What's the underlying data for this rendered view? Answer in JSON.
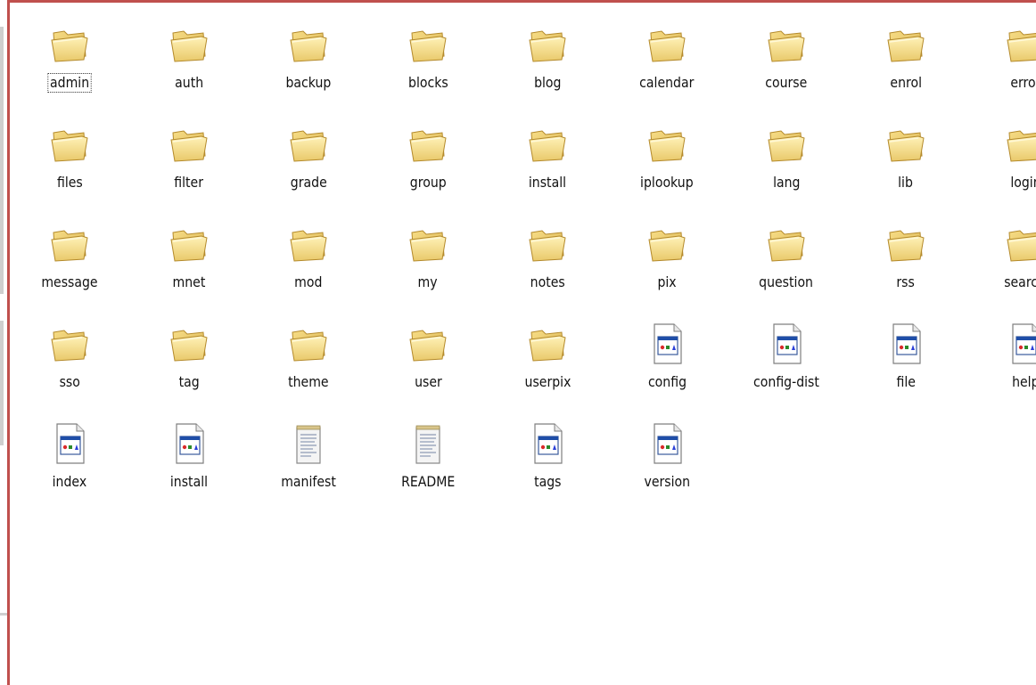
{
  "window": {
    "accent": "#c0504d"
  },
  "files": [
    {
      "name": "admin",
      "type": "folder",
      "focused": true
    },
    {
      "name": "auth",
      "type": "folder"
    },
    {
      "name": "backup",
      "type": "folder"
    },
    {
      "name": "blocks",
      "type": "folder"
    },
    {
      "name": "blog",
      "type": "folder"
    },
    {
      "name": "calendar",
      "type": "folder"
    },
    {
      "name": "course",
      "type": "folder"
    },
    {
      "name": "enrol",
      "type": "folder"
    },
    {
      "name": "error",
      "type": "folder"
    },
    {
      "name": "files",
      "type": "folder"
    },
    {
      "name": "filter",
      "type": "folder"
    },
    {
      "name": "grade",
      "type": "folder"
    },
    {
      "name": "group",
      "type": "folder"
    },
    {
      "name": "install",
      "type": "folder"
    },
    {
      "name": "iplookup",
      "type": "folder"
    },
    {
      "name": "lang",
      "type": "folder"
    },
    {
      "name": "lib",
      "type": "folder"
    },
    {
      "name": "login",
      "type": "folder"
    },
    {
      "name": "message",
      "type": "folder"
    },
    {
      "name": "mnet",
      "type": "folder"
    },
    {
      "name": "mod",
      "type": "folder"
    },
    {
      "name": "my",
      "type": "folder"
    },
    {
      "name": "notes",
      "type": "folder"
    },
    {
      "name": "pix",
      "type": "folder"
    },
    {
      "name": "question",
      "type": "folder"
    },
    {
      "name": "rss",
      "type": "folder"
    },
    {
      "name": "search",
      "type": "folder"
    },
    {
      "name": "sso",
      "type": "folder"
    },
    {
      "name": "tag",
      "type": "folder"
    },
    {
      "name": "theme",
      "type": "folder"
    },
    {
      "name": "user",
      "type": "folder"
    },
    {
      "name": "userpix",
      "type": "folder"
    },
    {
      "name": "config",
      "type": "php-file"
    },
    {
      "name": "config-dist",
      "type": "php-file"
    },
    {
      "name": "file",
      "type": "php-file"
    },
    {
      "name": "help",
      "type": "php-file"
    },
    {
      "name": "index",
      "type": "php-file"
    },
    {
      "name": "install",
      "type": "php-file"
    },
    {
      "name": "manifest",
      "type": "text-file"
    },
    {
      "name": "README",
      "type": "text-file"
    },
    {
      "name": "tags",
      "type": "php-file"
    },
    {
      "name": "version",
      "type": "php-file"
    }
  ]
}
